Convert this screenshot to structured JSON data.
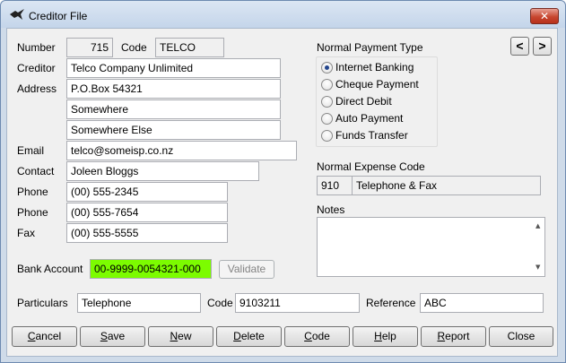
{
  "window": {
    "title": "Creditor File",
    "close_glyph": "✕"
  },
  "labels": {
    "number": "Number",
    "code": "Code",
    "creditor": "Creditor",
    "address": "Address",
    "email": "Email",
    "contact": "Contact",
    "phone1": "Phone",
    "phone2": "Phone",
    "fax": "Fax",
    "bank_account": "Bank Account",
    "particulars": "Particulars",
    "code2": "Code",
    "reference": "Reference",
    "payment_type": "Normal Payment Type",
    "expense_code": "Normal Expense Code",
    "notes": "Notes"
  },
  "values": {
    "number": "715",
    "code": "TELCO",
    "creditor": "Telco Company Unlimited",
    "address1": "P.O.Box 54321",
    "address2": "Somewhere",
    "address3": "Somewhere Else",
    "email": "telco@someisp.co.nz",
    "contact": "Joleen Bloggs",
    "phone1": "(00) 555-2345",
    "phone2": "(00) 555-7654",
    "fax": "(00) 555-5555",
    "bank_account": "00-9999-0054321-000",
    "particulars": "Telephone",
    "code2": "9103211",
    "reference": "ABC",
    "expense_code": "910",
    "expense_name": "Telephone & Fax",
    "notes": ""
  },
  "payment_types": [
    {
      "label": "Internet Banking",
      "checked": true
    },
    {
      "label": "Cheque Payment",
      "checked": false
    },
    {
      "label": "Direct Debit",
      "checked": false
    },
    {
      "label": "Auto Payment",
      "checked": false
    },
    {
      "label": "Funds Transfer",
      "checked": false
    }
  ],
  "nav": {
    "prev": "<",
    "next": ">"
  },
  "validate_button": "Validate",
  "buttons": [
    {
      "key": "C",
      "rest": "ancel"
    },
    {
      "key": "S",
      "rest": "ave"
    },
    {
      "key": "N",
      "rest": "ew"
    },
    {
      "key": "D",
      "rest": "elete"
    },
    {
      "key": "C",
      "rest": "ode"
    },
    {
      "key": "H",
      "rest": "elp"
    },
    {
      "key": "R",
      "rest": "eport"
    },
    {
      "key": "",
      "rest": "Close"
    }
  ],
  "colors": {
    "bank_account_bg": "#7cfc00",
    "close_button": "#c7462f"
  },
  "icons": {
    "app": "bird-icon",
    "close": "close-icon",
    "scroll_up": "scroll-up-icon",
    "scroll_down": "scroll-down-icon"
  }
}
